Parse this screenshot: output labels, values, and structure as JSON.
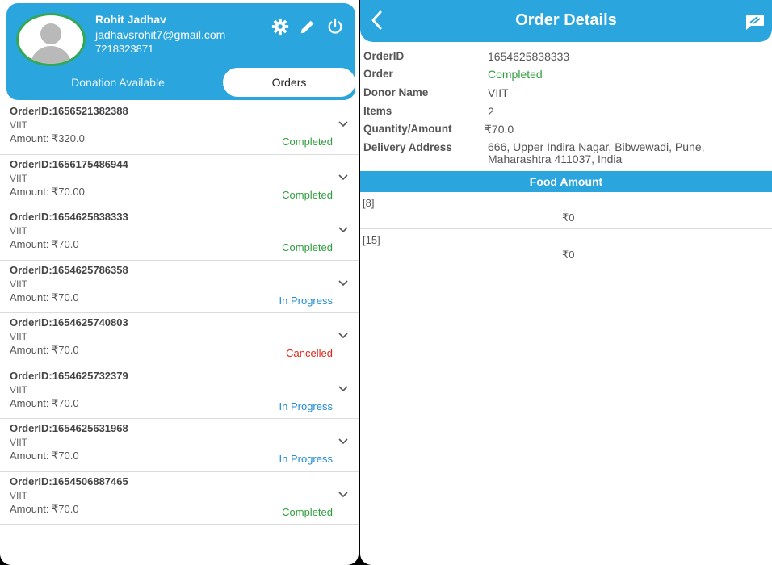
{
  "profile": {
    "name": "Rohit Jadhav",
    "email": "jadhavsrohit7@gmail.com",
    "phone": "7218323871"
  },
  "tabs": {
    "donation": "Donation Available",
    "orders": "Orders"
  },
  "orders": [
    {
      "id": "OrderID:1656521382388",
      "donor": "VIIT",
      "amount": "Amount: ₹320.0",
      "status": "Completed",
      "status_color": "#2e9e3c"
    },
    {
      "id": "OrderID:1656175486944",
      "donor": "VIIT",
      "amount": "Amount: ₹70.00",
      "status": "Completed",
      "status_color": "#2e9e3c"
    },
    {
      "id": "OrderID:1654625838333",
      "donor": "VIIT",
      "amount": "Amount: ₹70.0",
      "status": "Completed",
      "status_color": "#2e9e3c"
    },
    {
      "id": "OrderID:1654625786358",
      "donor": "VIIT",
      "amount": "Amount: ₹70.0",
      "status": "In Progress",
      "status_color": "#1f8ccf"
    },
    {
      "id": "OrderID:1654625740803",
      "donor": "VIIT",
      "amount": "Amount: ₹70.0",
      "status": "Cancelled",
      "status_color": "#e0241b"
    },
    {
      "id": "OrderID:1654625732379",
      "donor": "VIIT",
      "amount": "Amount: ₹70.0",
      "status": "In Progress",
      "status_color": "#1f8ccf"
    },
    {
      "id": "OrderID:1654625631968",
      "donor": "VIIT",
      "amount": "Amount: ₹70.0",
      "status": "In Progress",
      "status_color": "#1f8ccf"
    },
    {
      "id": "OrderID:1654506887465",
      "donor": "VIIT",
      "amount": "Amount: ₹70.0",
      "status": "Completed",
      "status_color": "#2e9e3c"
    }
  ],
  "details": {
    "title": "Order Details",
    "rows": [
      {
        "label": "OrderID",
        "value": "1654625838333"
      },
      {
        "label": "Order",
        "value": "Completed"
      },
      {
        "label": "Donor Name",
        "value": "VIIT"
      },
      {
        "label": "Items",
        "value": "2"
      },
      {
        "label": "Quantity/Amount",
        "value": "₹70.0"
      },
      {
        "label": "Delivery Address",
        "value": "666, Upper Indira Nagar, Bibwewadi, Pune, Maharashtra 411037, India"
      }
    ],
    "food_header": "Food Amount",
    "foods": [
      {
        "name": "[8]",
        "amount": "₹0"
      },
      {
        "name": "[15]",
        "amount": "₹0"
      }
    ]
  },
  "colors": {
    "accent": "#2aa5dd",
    "completed": "#2e9e3c"
  },
  "icons": [
    "gear-icon",
    "pencil-icon",
    "power-icon",
    "chevron-down-icon",
    "back-arrow-icon",
    "chat-icon"
  ]
}
